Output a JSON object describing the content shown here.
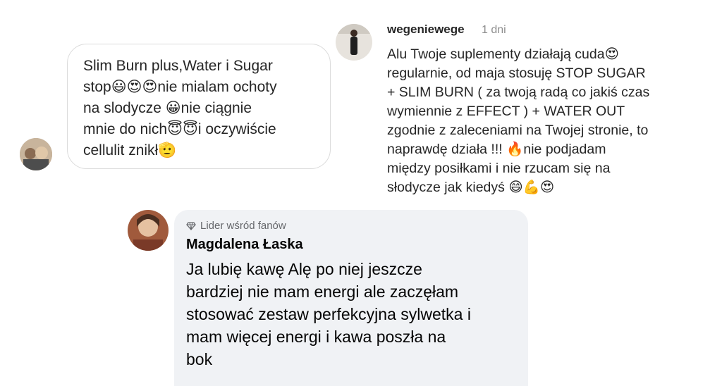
{
  "comment1": {
    "text": "Slim Burn plus,Water i Sugar\nstop😃😍😍nie mialam ochoty\nna slodycze 😀nie ciągnie\nmnie do nich😇😇i oczywiście\ncellulit znikł🫡"
  },
  "comment2": {
    "username": "wegeniewege",
    "time": "1 dni",
    "text": "Alu Twoje suplementy działają cuda😍\nregularnie, od maja stosuję STOP SUGAR\n+ SLIM BURN ( za twoją radą co jakiś czas\nwymiennie z EFFECT ) + WATER OUT\nzgodnie z zaleceniami na Twojej stronie, to\nnaprawdę działa !!! 🔥nie podjadam\nmiędzy posiłkami i nie rzucam się na\nsłodycze jak kiedyś 😄💪😍"
  },
  "comment3": {
    "badge": "Lider wśród fanów",
    "name": "Magdalena Łaska",
    "text": "Ja lubię kawę Alę po niej jeszcze\nbardziej nie mam energi ale zaczęłam\nstosować zestaw perfekcyjna sylwetka i\nmam więcej energi i kawa poszła na\nbok"
  }
}
